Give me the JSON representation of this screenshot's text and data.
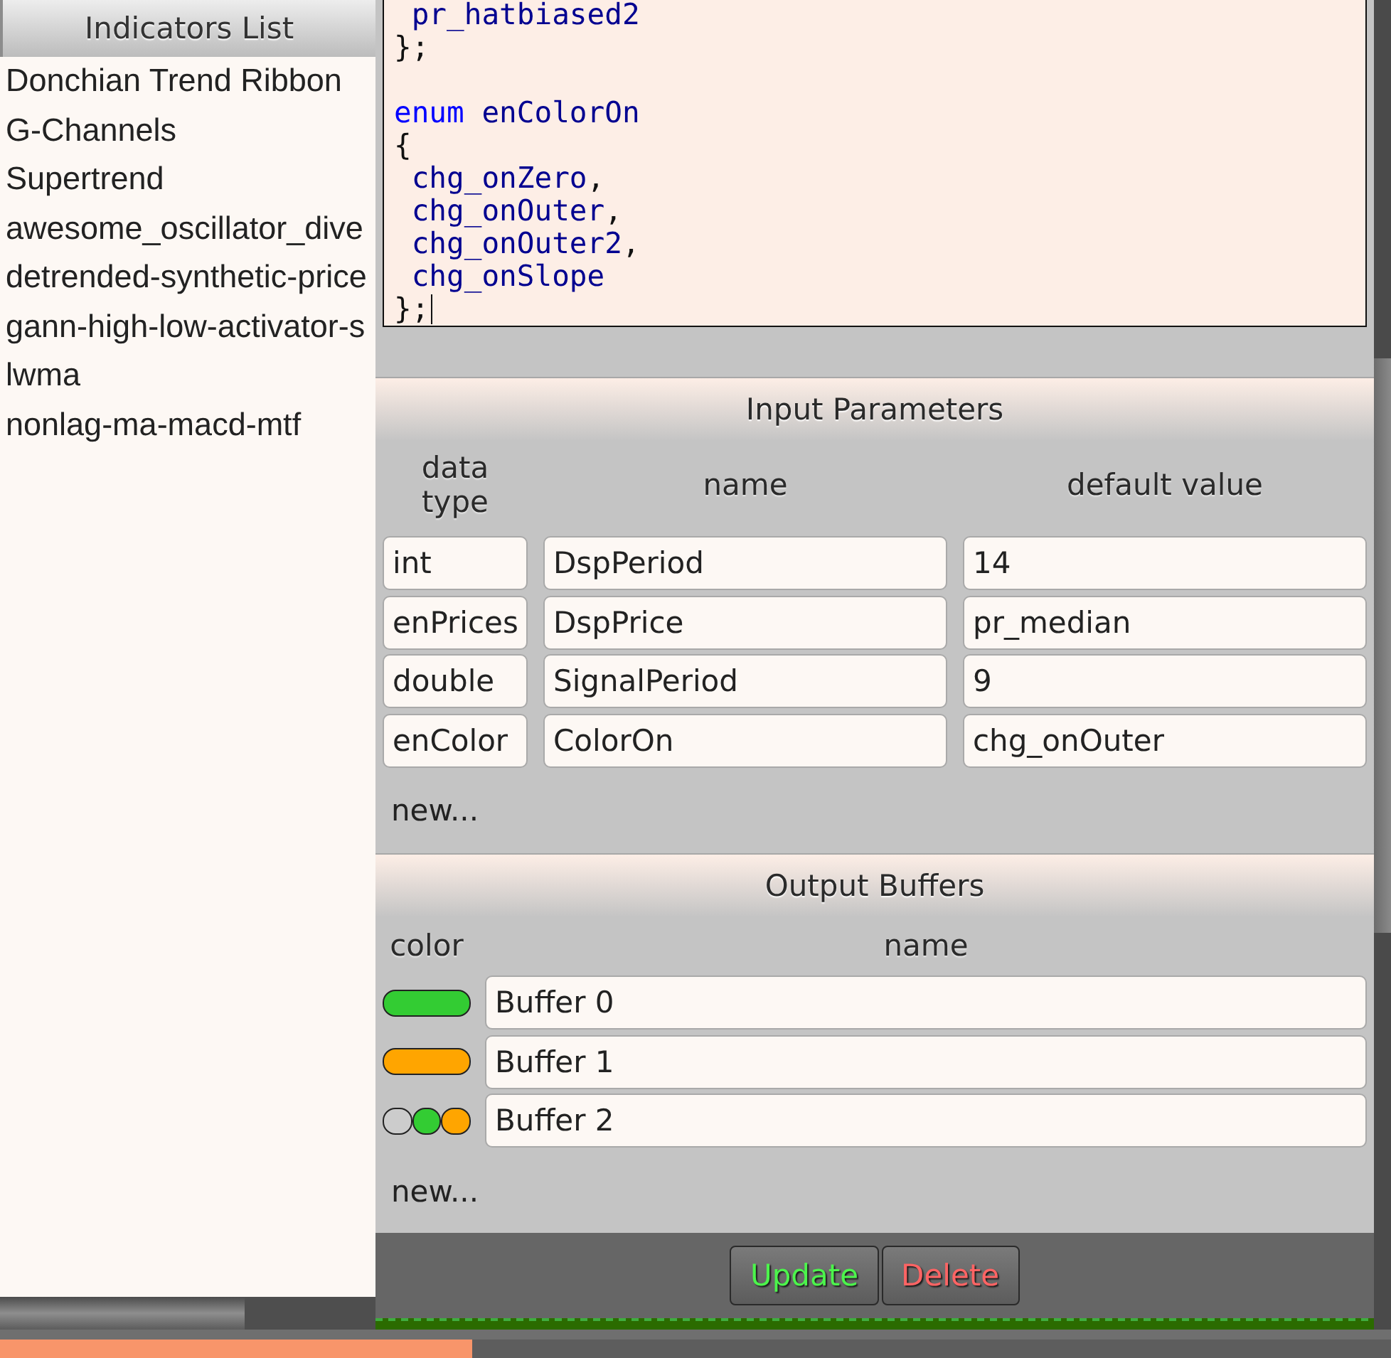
{
  "indicators_list": {
    "title": "Indicators List",
    "items": [
      {
        "label": "Donchian Trend Ribbon",
        "selected": false
      },
      {
        "label": "G-Channels",
        "selected": false
      },
      {
        "label": "Supertrend",
        "selected": false
      },
      {
        "label": "awesome_oscillator_dive",
        "selected": false
      },
      {
        "label": "detrended-synthetic-price",
        "selected": false
      },
      {
        "label": "gann-high-low-activator-s",
        "selected": false
      },
      {
        "label": "lwma",
        "selected": false
      },
      {
        "label": "nonlag-ma-macd-mtf",
        "selected": false
      }
    ]
  },
  "code_editor": {
    "lines": [
      {
        "kind": "code",
        "caret": false,
        "tokens": [
          {
            "kind": "identifier",
            "text": " pr_hatbiased2"
          }
        ]
      },
      {
        "kind": "code",
        "caret": false,
        "tokens": [
          {
            "kind": "punct",
            "text": "};"
          }
        ]
      },
      {
        "kind": "blank",
        "caret": false
      },
      {
        "kind": "code",
        "caret": false,
        "tokens": [
          {
            "kind": "keyword",
            "text": "enum"
          },
          {
            "kind": "identifier",
            "text": " enColorOn"
          }
        ]
      },
      {
        "kind": "code",
        "caret": false,
        "tokens": [
          {
            "kind": "punct",
            "text": "{"
          }
        ]
      },
      {
        "kind": "code",
        "caret": false,
        "tokens": [
          {
            "kind": "identifier",
            "text": " chg_onZero"
          },
          {
            "kind": "punct",
            "text": ","
          }
        ]
      },
      {
        "kind": "code",
        "caret": false,
        "tokens": [
          {
            "kind": "identifier",
            "text": " chg_onOuter"
          },
          {
            "kind": "punct",
            "text": ","
          }
        ]
      },
      {
        "kind": "code",
        "caret": false,
        "tokens": [
          {
            "kind": "identifier",
            "text": " chg_onOuter2"
          },
          {
            "kind": "punct",
            "text": ","
          }
        ]
      },
      {
        "kind": "code",
        "caret": false,
        "tokens": [
          {
            "kind": "identifier",
            "text": " chg_onSlope"
          }
        ]
      },
      {
        "kind": "code",
        "caret": true,
        "tokens": [
          {
            "kind": "punct",
            "text": "};"
          }
        ]
      }
    ]
  },
  "input_parameters": {
    "title": "Input Parameters",
    "columns": [
      "data type",
      "name",
      "default value"
    ],
    "rows": [
      {
        "data_type": "int",
        "name": "DspPeriod",
        "default_value": "14"
      },
      {
        "data_type": "enPrices",
        "name": "DspPrice",
        "default_value": "pr_median"
      },
      {
        "data_type": "double",
        "name": "SignalPeriod",
        "default_value": "9"
      },
      {
        "data_type": "enColor",
        "name": "ColorOn",
        "default_value": "chg_onOuter"
      }
    ],
    "new_link": "new..."
  },
  "output_buffers": {
    "title": "Output Buffers",
    "columns": [
      "color",
      "name"
    ],
    "rows": [
      {
        "swatches": [
          {
            "color": "#33cc33"
          }
        ],
        "name": "Buffer 0"
      },
      {
        "swatches": [
          {
            "color": "#ffa500"
          }
        ],
        "name": "Buffer 1"
      },
      {
        "swatches": [
          {
            "color": "#cccccc"
          },
          {
            "color": "#33cc33"
          },
          {
            "color": "#ffa500"
          }
        ],
        "name": "Buffer 2"
      }
    ],
    "new_link": "new..."
  },
  "actions": [
    {
      "kind": "update",
      "label": "Update"
    },
    {
      "kind": "delete",
      "label": "Delete"
    }
  ]
}
